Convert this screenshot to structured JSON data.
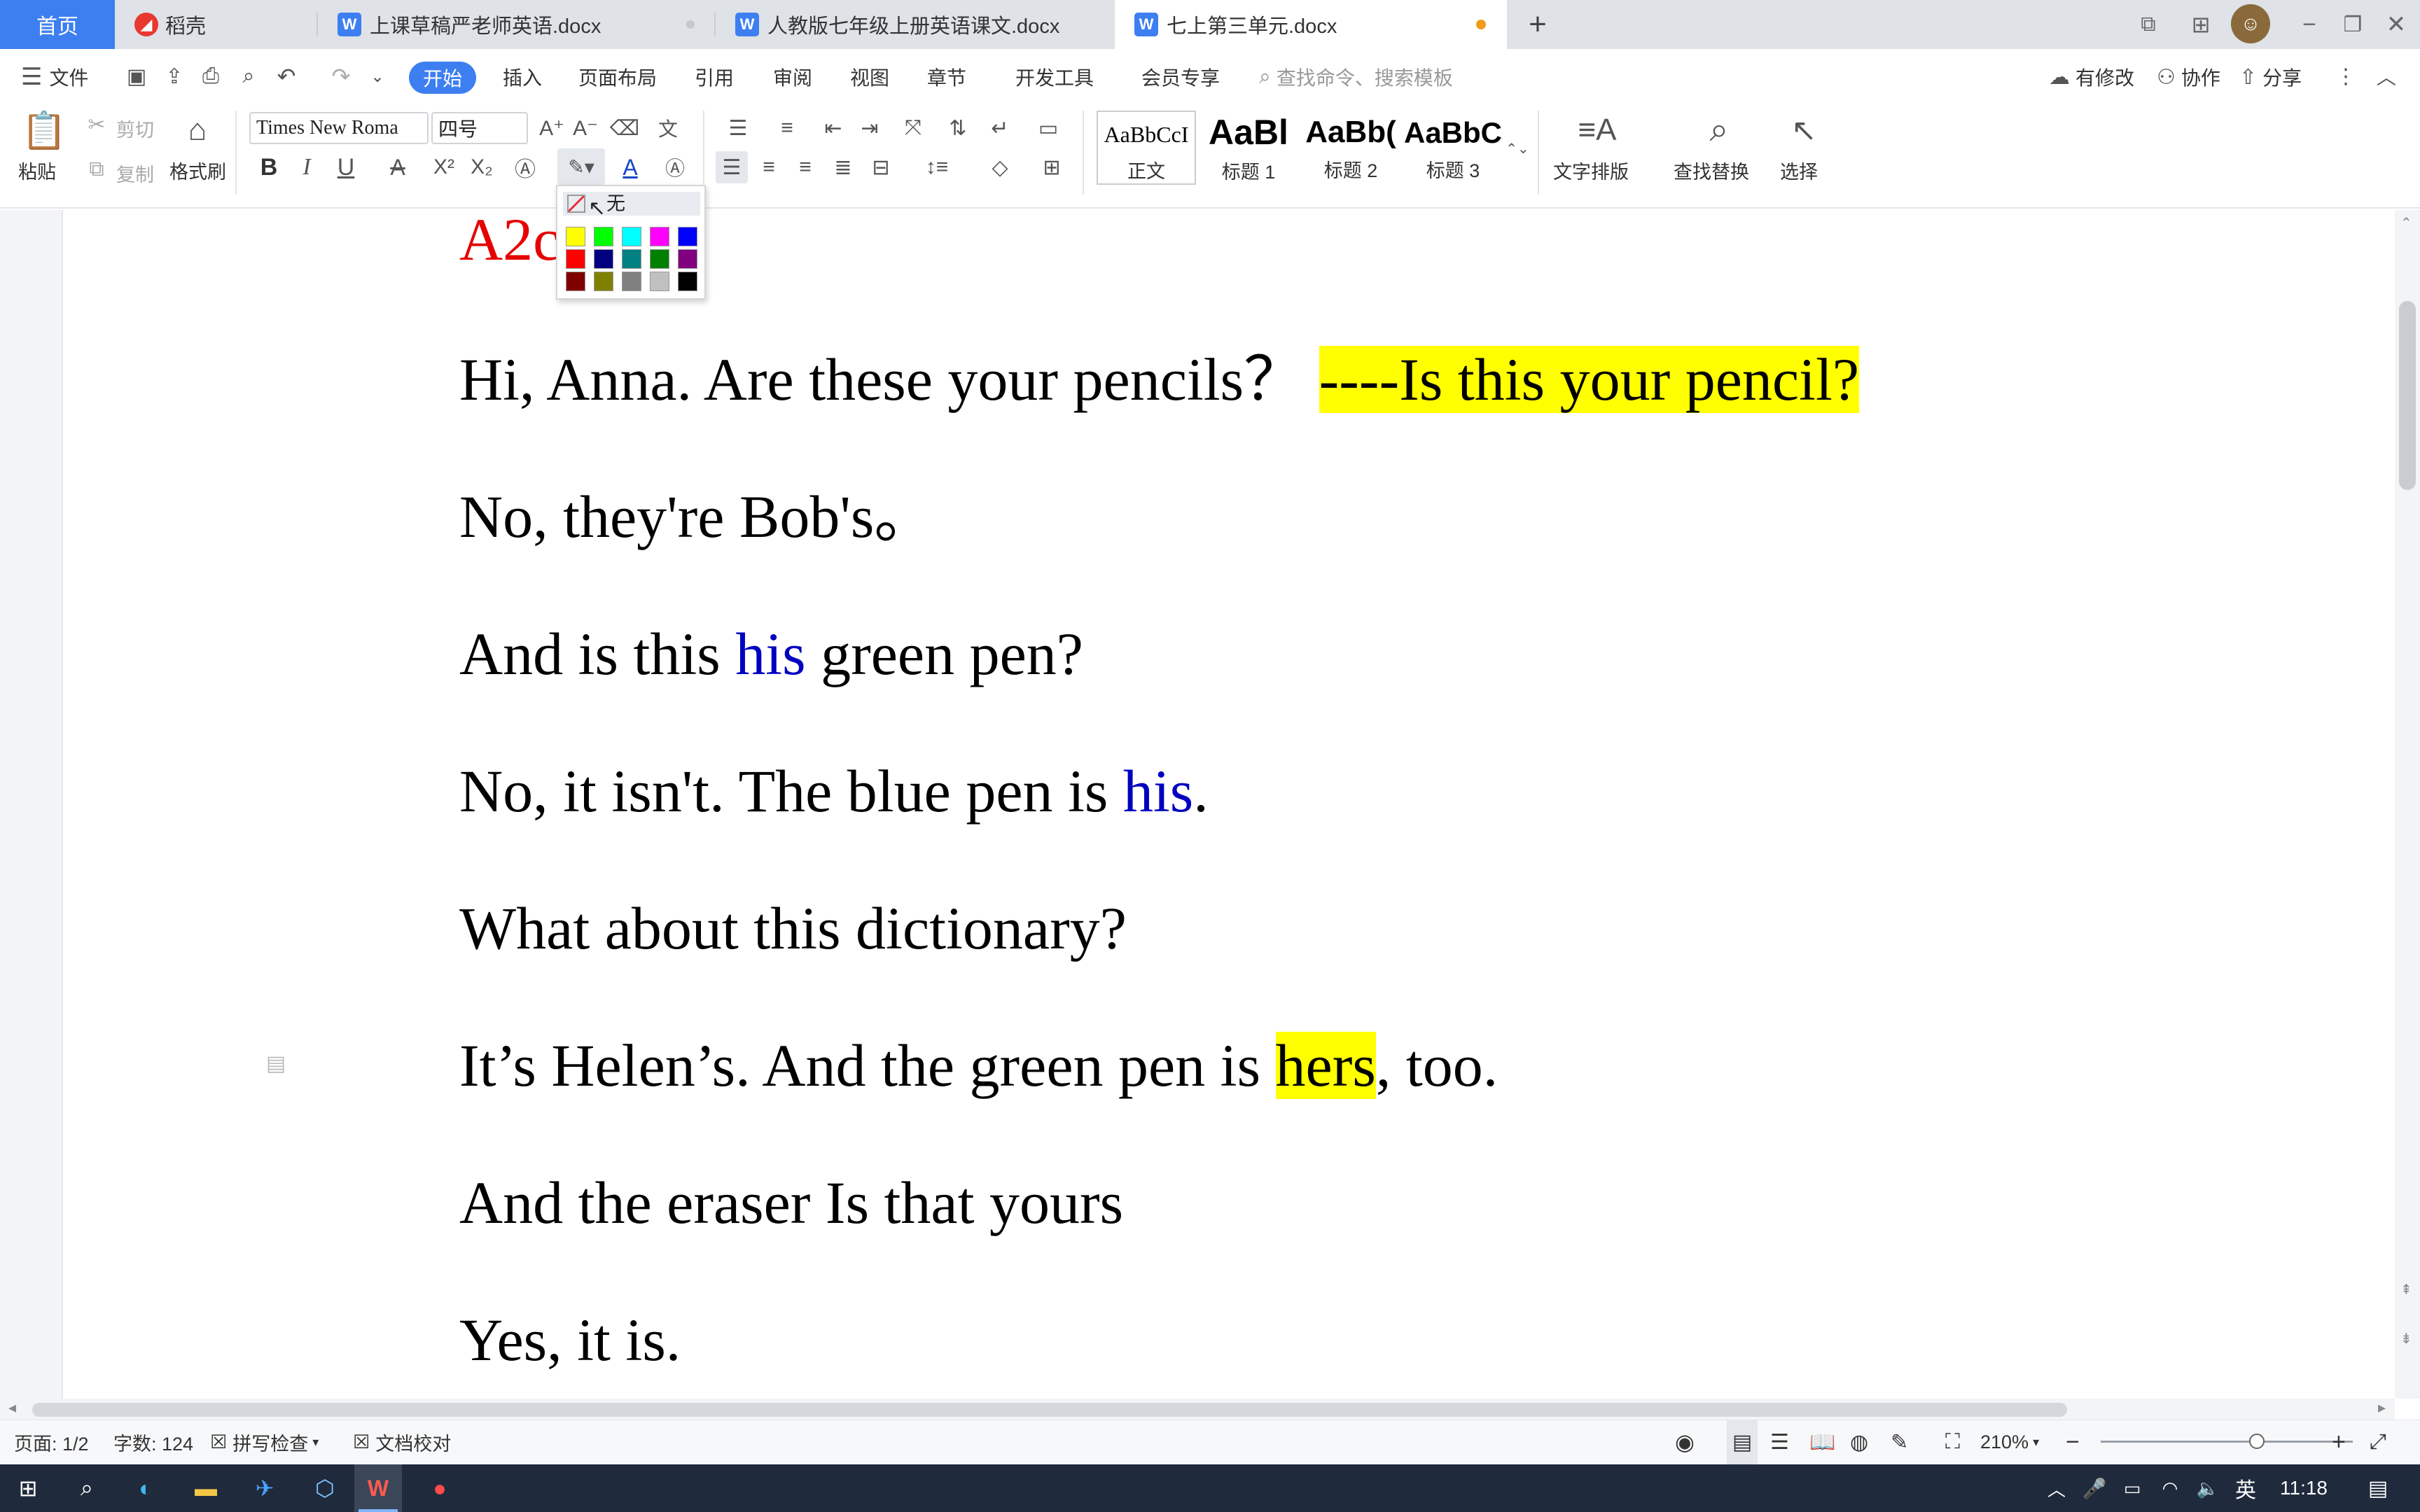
{
  "tabs": {
    "home": "首页",
    "daoke": "稻壳",
    "doc1": "上课草稿严老师英语.docx",
    "doc2": "人教版七年级上册英语课文.docx",
    "doc3": "七上第三单元.docx",
    "new_tab": "+"
  },
  "menu": {
    "file": "文件",
    "tabs": [
      "开始",
      "插入",
      "页面布局",
      "引用",
      "审阅",
      "视图",
      "章节",
      "开发工具",
      "会员专享"
    ],
    "search_placeholder": "查找命令、搜索模板",
    "has_changes": "有修改",
    "collaborate": "协作",
    "share": "分享"
  },
  "ribbon": {
    "paste": "粘贴",
    "cut": "剪切",
    "copy": "复制",
    "format_painter": "格式刷",
    "font_name": "Times New Roma",
    "font_size": "四号",
    "styles": [
      {
        "preview": "AaBbCcI",
        "name": "正文"
      },
      {
        "preview": "AaBl",
        "name": "标题 1"
      },
      {
        "preview": "AaBb(",
        "name": "标题 2"
      },
      {
        "preview": "AaBbC",
        "name": "标题 3"
      }
    ],
    "text_layout": "文字排版",
    "find_replace": "查找替换",
    "select": "选择"
  },
  "highlight_popup": {
    "none_label": "无",
    "colors": [
      "#ffff00",
      "#00ff00",
      "#00ffff",
      "#ff00ff",
      "#0000ff",
      "#ff0000",
      "#000080",
      "#008080",
      "#008000",
      "#800080",
      "#800000",
      "#808000",
      "#808080",
      "#c0c0c0",
      "#000000"
    ]
  },
  "document": {
    "heading": "A2c",
    "lines": [
      {
        "parts": [
          {
            "t": "Hi, Anna. Are these your pencils？ "
          },
          {
            "t": "----Is this your pencil?",
            "s": "hl"
          }
        ]
      },
      {
        "parts": [
          {
            "t": "No, they're Bob's。"
          }
        ]
      },
      {
        "parts": [
          {
            "t": "And is this "
          },
          {
            "t": "his",
            "s": "blue"
          },
          {
            "t": " green pen?"
          }
        ]
      },
      {
        "parts": [
          {
            "t": "No, it isn't. The blue pen is "
          },
          {
            "t": "his",
            "s": "blue"
          },
          {
            "t": "."
          }
        ]
      },
      {
        "parts": [
          {
            "t": "What about this dictionary?"
          }
        ]
      },
      {
        "parts": [
          {
            "t": "It’s Helen’s. And the green pen is "
          },
          {
            "t": "hers",
            "s": "hl"
          },
          {
            "t": ", too."
          }
        ]
      },
      {
        "parts": [
          {
            "t": "And the eraser Is that yours"
          }
        ]
      },
      {
        "parts": [
          {
            "t": "Yes, it is."
          }
        ]
      }
    ]
  },
  "status": {
    "page": "页面: 1/2",
    "word_count": "字数: 124",
    "spell_check": "拼写检查",
    "doc_proof": "文档校对",
    "zoom": "210%",
    "zoom_fraction": 0.62
  },
  "taskbar": {
    "ime": "英",
    "time": "11:18"
  },
  "colors": {
    "accent": "#3d7ff0",
    "highlight": "#ffff00",
    "heading_red": "#e60000",
    "text_blue": "#0000c0"
  }
}
